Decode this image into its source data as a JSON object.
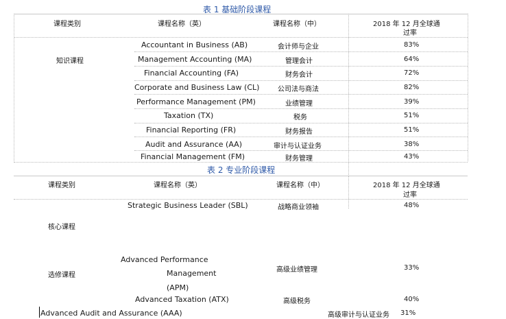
{
  "table1": {
    "title": "表 1  基础阶段课程",
    "headers": {
      "category": "课程类别",
      "name_en": "课程名称（英）",
      "name_cn": "课程名称（中）",
      "pass_rate_line1": "2018 年 12 月全球通",
      "pass_rate_line2": "过率"
    },
    "category_label": "知识课程",
    "rows": [
      {
        "en": "Accountant in Business (AB)",
        "cn": "会计师与企业",
        "rate": "83%"
      },
      {
        "en": "Management Accounting (MA)",
        "cn": "管理会计",
        "rate": "64%"
      },
      {
        "en": "Financial Accounting (FA)",
        "cn": "财务会计",
        "rate": "72%"
      },
      {
        "en": "Corporate and Business Law (CL)",
        "cn": "公司法与商法",
        "rate": "82%"
      },
      {
        "en": "Performance Management (PM)",
        "cn": "业绩管理",
        "rate": "39%"
      },
      {
        "en": "Taxation (TX)",
        "cn": "税务",
        "rate": "51%"
      },
      {
        "en": "Financial Reporting (FR)",
        "cn": "财务报告",
        "rate": "51%"
      },
      {
        "en": "Audit and Assurance (AA)",
        "cn": "审计与认证业务",
        "rate": "38%"
      },
      {
        "en": "Financial Management (FM)",
        "cn": "财务管理",
        "rate": "43%"
      }
    ]
  },
  "table2": {
    "title": "表 2 专业阶段课程",
    "headers": {
      "category": "课程类别",
      "name_en": "课程名称（英）",
      "name_cn": "课程名称（中）",
      "pass_rate_line1": "2018 年 12 月全球通",
      "pass_rate_line2": "过率"
    },
    "core_label": "核心课程",
    "elective_label": "选修课程",
    "rows": {
      "sbl": {
        "en": "Strategic Business Leader (SBL)",
        "cn": "战略商业领袖",
        "rate": "48%"
      },
      "apm": {
        "en_line1": "Advanced Performance",
        "en_line2": "Management",
        "en_line3": "(APM)",
        "cn": "高级业绩管理",
        "rate": "33%"
      },
      "atx": {
        "en": "Advanced Taxation (ATX)",
        "cn": "高级税务",
        "rate": "40%"
      },
      "aaa": {
        "en": "Advanced Audit and Assurance (AAA)",
        "cn": "高级审计与认证业务",
        "rate": "31%"
      }
    }
  }
}
